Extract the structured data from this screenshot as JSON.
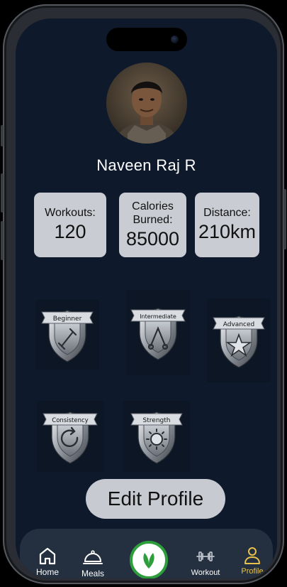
{
  "profile": {
    "name": "Naveen Raj R"
  },
  "stats": [
    {
      "label": "Workouts:",
      "value": "120"
    },
    {
      "label": "Calories\nBurned:",
      "value": "85000"
    },
    {
      "label": "Distance:",
      "value": "210km"
    }
  ],
  "badges": [
    {
      "label": "Beginner",
      "icon": "dumbbell-icon"
    },
    {
      "label": "Intermediate",
      "icon": "weights-icon"
    },
    {
      "label": "Advanced",
      "icon": "star-icon"
    },
    {
      "label": "Consistency",
      "icon": "refresh-icon"
    },
    {
      "label": "Strength",
      "icon": "sun-icon"
    }
  ],
  "actions": {
    "edit_profile": "Edit Profile"
  },
  "nav": {
    "home": "Home",
    "meals": "Meals",
    "workout": "Workout",
    "profile": "Profile",
    "active": "profile",
    "active_color": "#e8c24a",
    "center_ring_color": "#2e9e3c"
  }
}
